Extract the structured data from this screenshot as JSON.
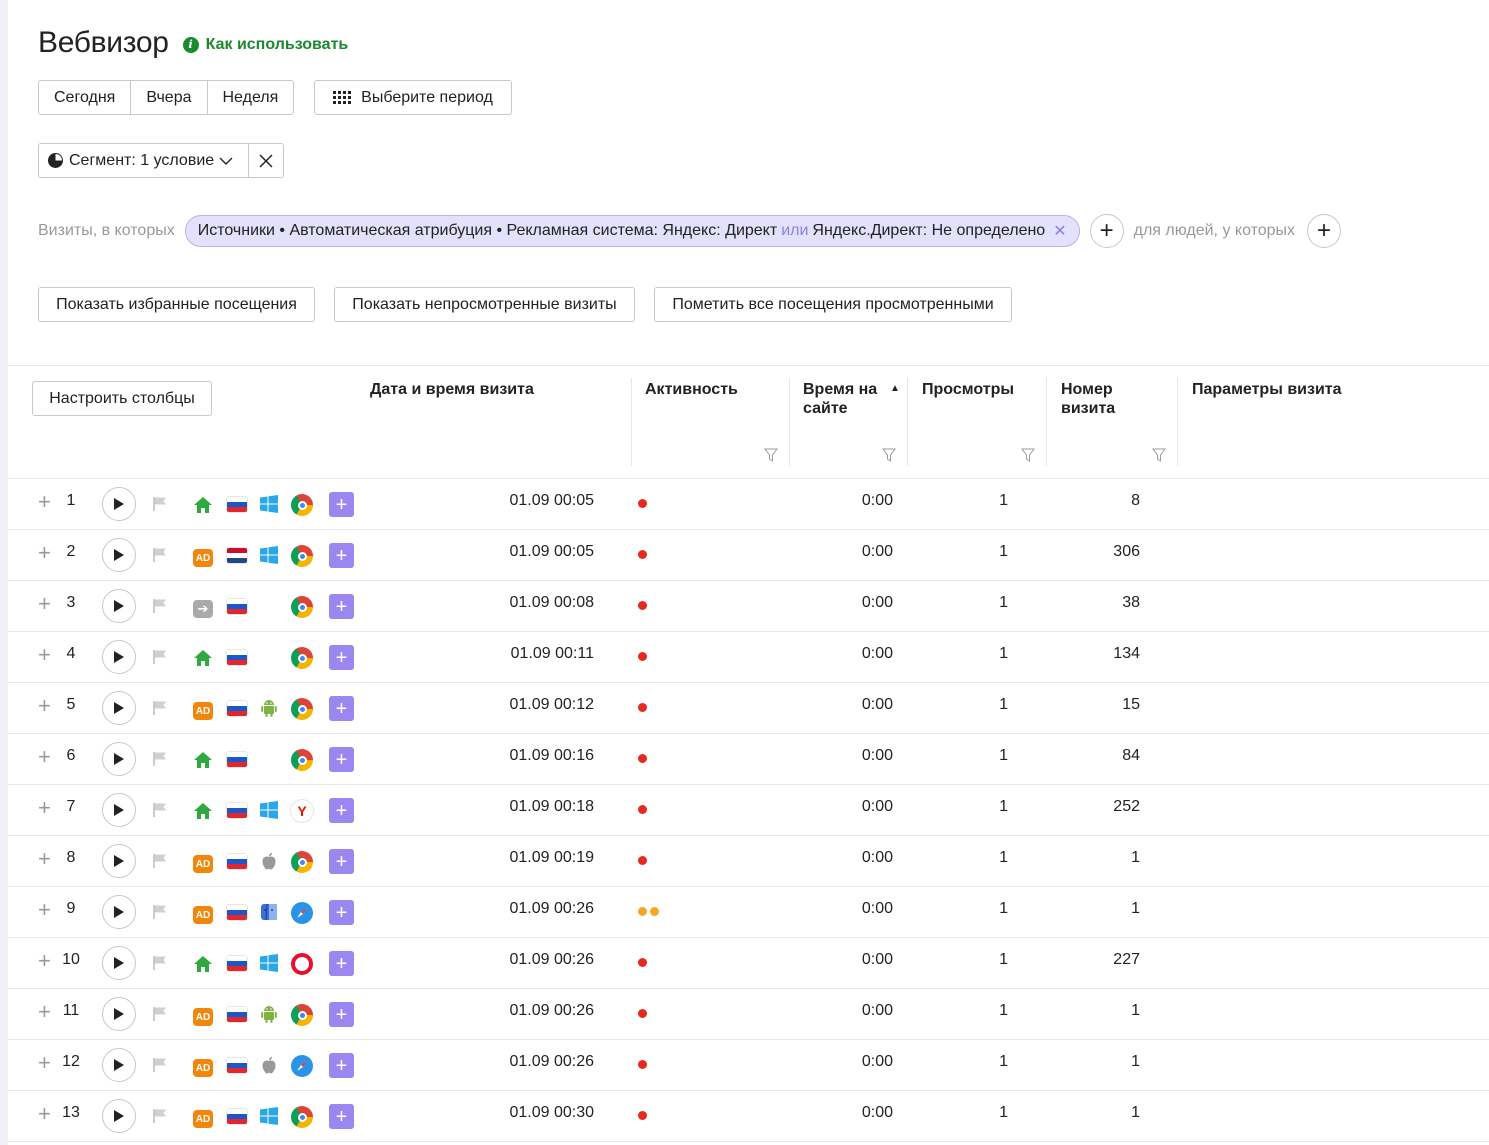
{
  "title": "Вебвизор",
  "howto": "Как использовать",
  "periods": [
    "Сегодня",
    "Вчера",
    "Неделя"
  ],
  "period_picker": "Выберите период",
  "segment": "Сегмент: 1 условие",
  "conditions": {
    "visits_label": "Визиты, в которых",
    "chip_part1": "Источники • Автоматическая атрибуция • Рекламная система: Яндекс: Директ",
    "chip_or": "или",
    "chip_part2": "Яндекс.Директ: Не определено",
    "people_label": "для людей, у которых"
  },
  "actions": {
    "favorites": "Показать избранные посещения",
    "unviewed": "Показать непросмотренные визиты",
    "mark_all": "Пометить все посещения просмотренными"
  },
  "configure_columns": "Настроить столбцы",
  "columns": {
    "date": "Дата и время визита",
    "activity": "Активность",
    "time_on_site_1": "Время на",
    "time_on_site_2": "сайте",
    "views": "Просмотры",
    "visit_number_1": "Номер",
    "visit_number_2": "визита",
    "params": "Параметры визита"
  },
  "colors": {
    "accent_purple": "#9b87f0",
    "green": "#1b8a2f",
    "ad_orange": "#f2860b",
    "activity_red": "#e8281e",
    "activity_orange": "#f5a623"
  },
  "rows": [
    {
      "n": "1",
      "src": "home",
      "country": "ru",
      "os": "windows",
      "browser": "chrome",
      "date": "01.09 00:05",
      "activity": "red",
      "time": "0:00",
      "views": "1",
      "visit": "8"
    },
    {
      "n": "2",
      "src": "ad",
      "country": "nl",
      "os": "windows",
      "browser": "chrome",
      "date": "01.09 00:05",
      "activity": "red",
      "time": "0:00",
      "views": "1",
      "visit": "306"
    },
    {
      "n": "3",
      "src": "enter",
      "country": "ru",
      "os": "",
      "browser": "chrome",
      "date": "01.09 00:08",
      "activity": "red",
      "time": "0:00",
      "views": "1",
      "visit": "38"
    },
    {
      "n": "4",
      "src": "home",
      "country": "ru",
      "os": "",
      "browser": "chrome",
      "date": "01.09 00:11",
      "activity": "red",
      "time": "0:00",
      "views": "1",
      "visit": "134"
    },
    {
      "n": "5",
      "src": "ad",
      "country": "ru",
      "os": "android",
      "browser": "chrome",
      "date": "01.09 00:12",
      "activity": "red",
      "time": "0:00",
      "views": "1",
      "visit": "15"
    },
    {
      "n": "6",
      "src": "home",
      "country": "ru",
      "os": "",
      "browser": "chrome",
      "date": "01.09 00:16",
      "activity": "red",
      "time": "0:00",
      "views": "1",
      "visit": "84"
    },
    {
      "n": "7",
      "src": "home",
      "country": "ru",
      "os": "windows",
      "browser": "yandex",
      "date": "01.09 00:18",
      "activity": "red",
      "time": "0:00",
      "views": "1",
      "visit": "252"
    },
    {
      "n": "8",
      "src": "ad",
      "country": "ru",
      "os": "apple",
      "browser": "chrome",
      "date": "01.09 00:19",
      "activity": "red",
      "time": "0:00",
      "views": "1",
      "visit": "1"
    },
    {
      "n": "9",
      "src": "ad",
      "country": "ru",
      "os": "macos",
      "browser": "safari",
      "date": "01.09 00:26",
      "activity": "orange2",
      "time": "0:00",
      "views": "1",
      "visit": "1"
    },
    {
      "n": "10",
      "src": "home",
      "country": "ru",
      "os": "windows",
      "browser": "opera",
      "date": "01.09 00:26",
      "activity": "red",
      "time": "0:00",
      "views": "1",
      "visit": "227"
    },
    {
      "n": "11",
      "src": "ad",
      "country": "ru",
      "os": "android",
      "browser": "chrome",
      "date": "01.09 00:26",
      "activity": "red",
      "time": "0:00",
      "views": "1",
      "visit": "1"
    },
    {
      "n": "12",
      "src": "ad",
      "country": "ru",
      "os": "apple",
      "browser": "safari",
      "date": "01.09 00:26",
      "activity": "red",
      "time": "0:00",
      "views": "1",
      "visit": "1"
    },
    {
      "n": "13",
      "src": "ad",
      "country": "ru",
      "os": "windows",
      "browser": "chrome",
      "date": "01.09 00:30",
      "activity": "red",
      "time": "0:00",
      "views": "1",
      "visit": "1"
    }
  ]
}
